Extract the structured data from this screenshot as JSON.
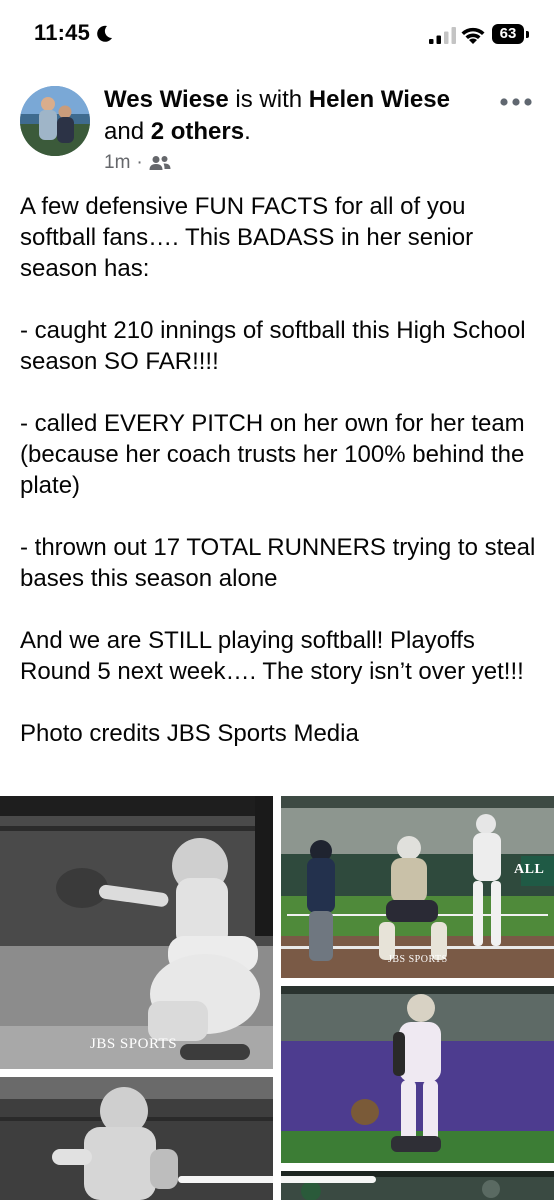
{
  "status_bar": {
    "time": "11:45",
    "battery": "63"
  },
  "post": {
    "author": "Wes Wiese",
    "with_text": "is with",
    "tagged": "Helen Wiese",
    "and_text": "and",
    "others": "2 others",
    "period": ".",
    "timestamp": "1m",
    "separator": "·",
    "paragraphs": [
      "A few defensive FUN FACTS for all of you softball fans…. This BADASS in her senior season has:",
      "- caught 210 innings of softball this High School season SO FAR!!!!",
      "- called EVERY PITCH on her own for her team (because her coach trusts her 100% behind the plate)",
      "- thrown out 17 TOTAL RUNNERS trying to steal bases this season alone",
      "And we are STILL playing softball!  Playoffs Round 5 next week…. The story isn’t over yet!!!",
      "Photo credits JBS Sports Media"
    ],
    "photo_watermarks": {
      "photo1": "JBS SPORTS",
      "photo2": "JBS SPORTS"
    },
    "photo_banner_text": "ALL"
  },
  "colors": {
    "meta_gray": "#65676b",
    "text": "#050505"
  }
}
